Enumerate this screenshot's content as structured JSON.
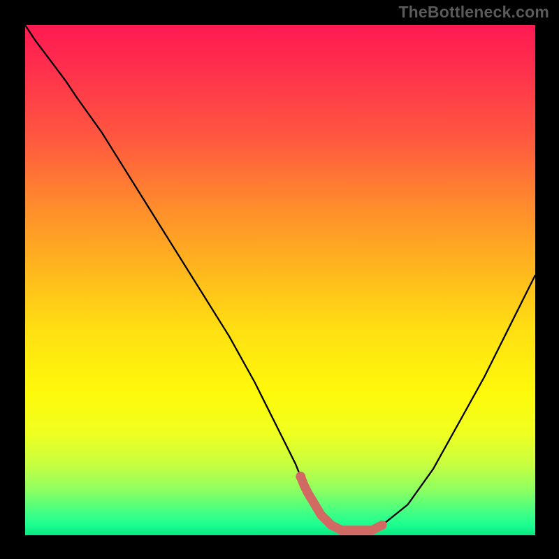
{
  "watermark": "TheBottleneck.com",
  "colors": {
    "curve": "#000000",
    "highlight": "#d26a64",
    "background_top": "#ff1a52",
    "background_bottom": "#08e77f"
  },
  "chart_data": {
    "type": "line",
    "title": "",
    "xlabel": "",
    "ylabel": "",
    "xlim": [
      0,
      100
    ],
    "ylim": [
      0,
      100
    ],
    "x": [
      0,
      2,
      5,
      8,
      10,
      15,
      20,
      25,
      30,
      35,
      40,
      45,
      50,
      53,
      55,
      58,
      60,
      62,
      65,
      68,
      70,
      75,
      80,
      85,
      90,
      95,
      100
    ],
    "values": [
      100,
      97,
      93,
      89,
      86,
      79,
      71,
      63,
      55,
      47,
      39,
      30,
      20,
      14,
      9,
      4,
      2,
      1,
      1,
      1,
      2,
      6,
      13,
      22,
      31,
      41,
      51
    ],
    "highlight_range_x": [
      54,
      70
    ],
    "series": [
      {
        "name": "bottleneck_curve",
        "x": [
          0,
          2,
          5,
          8,
          10,
          15,
          20,
          25,
          30,
          35,
          40,
          45,
          50,
          53,
          55,
          58,
          60,
          62,
          65,
          68,
          70,
          75,
          80,
          85,
          90,
          95,
          100
        ],
        "y": [
          100,
          97,
          93,
          89,
          86,
          79,
          71,
          63,
          55,
          47,
          39,
          30,
          20,
          14,
          9,
          4,
          2,
          1,
          1,
          1,
          2,
          6,
          13,
          22,
          31,
          41,
          51
        ]
      }
    ]
  }
}
